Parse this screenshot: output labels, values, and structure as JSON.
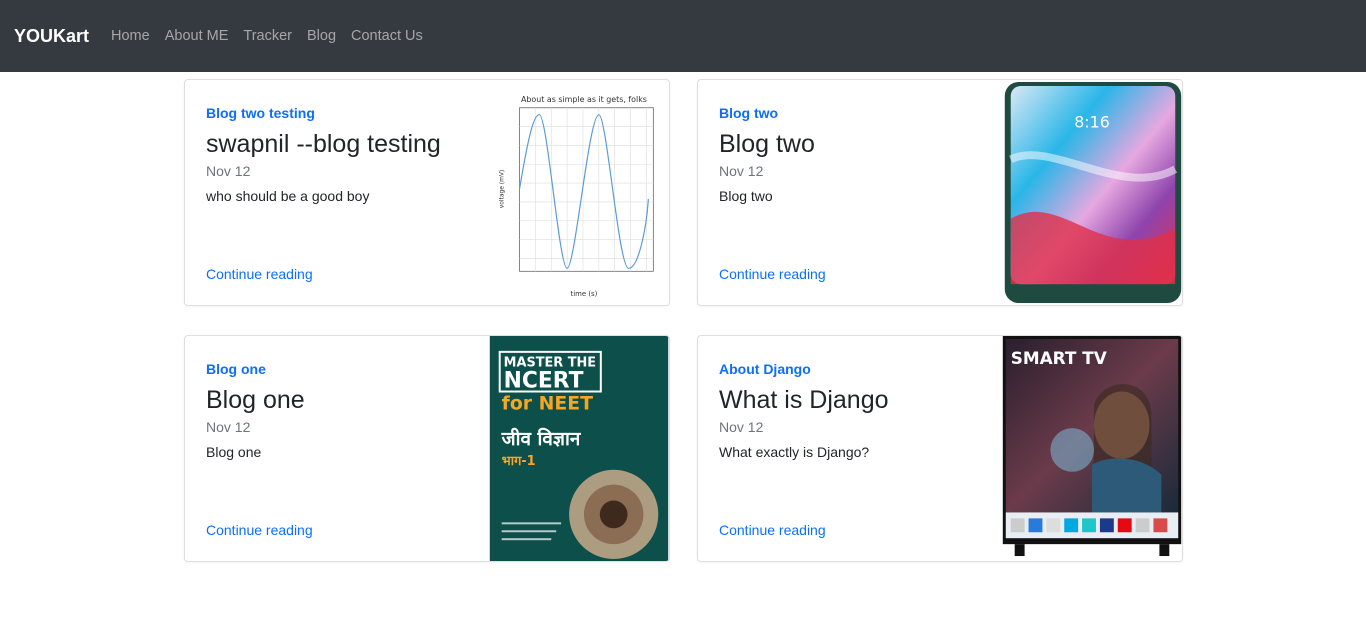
{
  "nav": {
    "brand": "YOUKart",
    "links": [
      "Home",
      "About ME",
      "Tracker",
      "Blog",
      "Contact Us"
    ]
  },
  "posts": [
    {
      "category": "Blog two testing",
      "title": "swapnil --blog testing",
      "date": "Nov 12",
      "excerpt": "who should be a good boy",
      "link": "Continue reading",
      "thumb_title": "About as simple as it gets, folks",
      "thumb_xlabel": "time (s)",
      "thumb_ylabel": "voltage (mV)"
    },
    {
      "category": "Blog two",
      "title": "Blog two",
      "date": "Nov 12",
      "excerpt": "Blog two",
      "link": "Continue reading",
      "thumb_time": "8:16"
    },
    {
      "category": "Blog one",
      "title": "Blog one",
      "date": "Nov 12",
      "excerpt": "Blog one",
      "link": "Continue reading",
      "thumb_lines": [
        "MASTER THE",
        "NCERT",
        "for NEET",
        "जीव विज्ञान",
        "भाग-1"
      ]
    },
    {
      "category": "About Django",
      "title": "What is Django",
      "date": "Nov 12",
      "excerpt": "What exactly is Django?",
      "link": "Continue reading",
      "thumb_text": "SMART TV"
    }
  ]
}
